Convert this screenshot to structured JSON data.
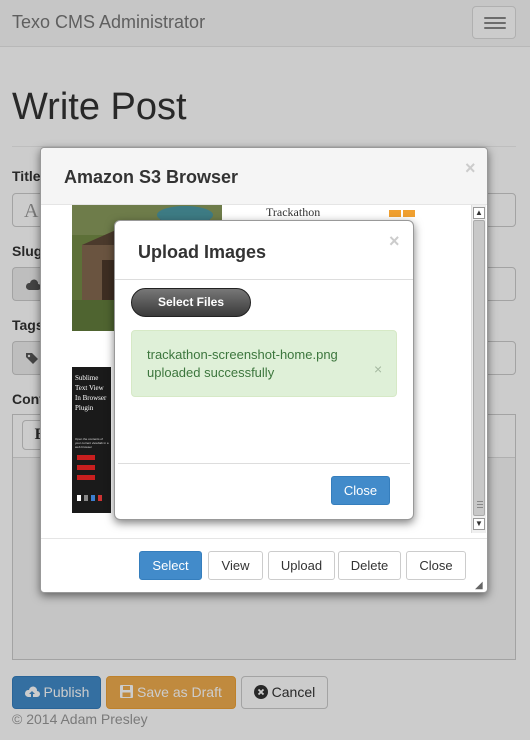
{
  "app": {
    "brand": "Texo CMS Administrator"
  },
  "page": {
    "title": "Write Post",
    "labels": {
      "title": "Title",
      "slug": "Slug",
      "tags": "Tags",
      "content": "Content"
    },
    "title_value": "A",
    "editor_toolbar": {
      "bold": "B"
    }
  },
  "actions": {
    "publish": "Publish",
    "save_draft": "Save as Draft",
    "cancel": "Cancel"
  },
  "footer": {
    "copyright": "© 2014 Adam Presley"
  },
  "s3_browser": {
    "title": "Amazon S3 Browser",
    "close_x": "×",
    "thumbnails": [
      {
        "name": "game-screenshot"
      },
      {
        "name": "trackathon-screenshot",
        "caption": "Trackathon"
      },
      {
        "name": "sublime-plugin-screenshot",
        "caption": "Sublime Text View In Browser Plugin",
        "small_text": "Open the contents of your current view/tab in a web browser"
      }
    ],
    "buttons": {
      "select": "Select",
      "view": "View",
      "upload": "Upload",
      "delete": "Delete",
      "close": "Close"
    },
    "scroll": {
      "up": "▲",
      "down": "▼"
    },
    "resize": "◢"
  },
  "upload": {
    "title": "Upload Images",
    "close_x": "×",
    "select_files": "Select Files",
    "alert": {
      "filename": "trackathon-screenshot-home.png",
      "message": "uploaded successfully",
      "close_x": "×"
    },
    "close": "Close"
  },
  "colors": {
    "primary": "#428bca",
    "warning": "#f0ad4e",
    "success_bg": "#dff0d8",
    "success_text": "#3c763d"
  }
}
